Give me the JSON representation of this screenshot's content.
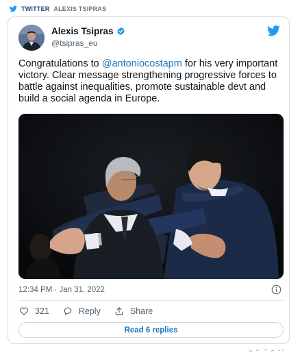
{
  "source": {
    "label": "TWITTER",
    "author": "ALEXIS TSIPRAS",
    "icon": "twitter-bird-icon"
  },
  "tweet": {
    "author_name": "Alexis Tsipras",
    "handle": "@tsipras_eu",
    "verified": true,
    "text_before": "Congratulations to ",
    "mention": "@antoniocostapm",
    "text_after": "  for his very important victory. Clear message strengthening progressive forces to battle against inequalities, promote sustainable devt and build a social agenda in Europe.",
    "timestamp": "12:34 PM · Jan 31, 2022",
    "photo": "photo of two men embracing"
  },
  "actions": {
    "like_count": "321",
    "reply_label": "Reply",
    "share_label": "Share"
  },
  "read_replies_label": "Read 6 replies",
  "colors": {
    "brand": "#1d9bf0",
    "link": "#1b76c1",
    "text": "#0f1419",
    "muted": "#536471",
    "border": "#cfd9de"
  }
}
